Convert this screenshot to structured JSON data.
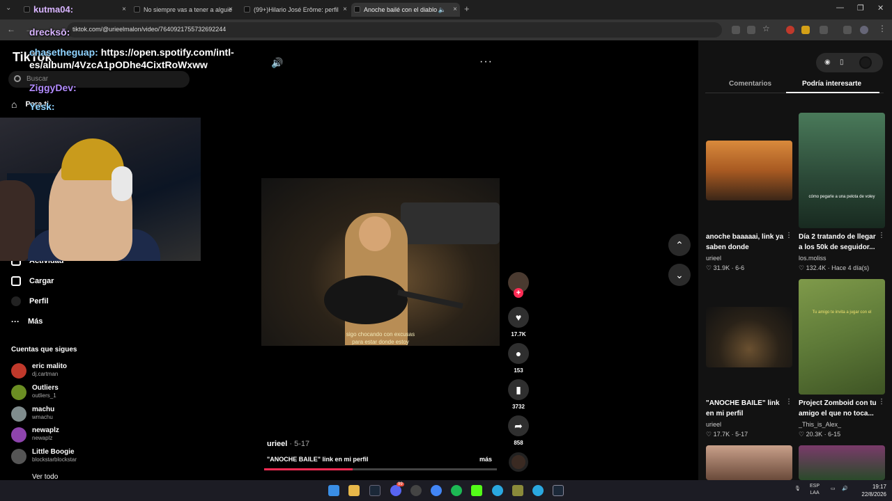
{
  "browser": {
    "tabs": [
      {
        "label": "kutma04:",
        "active": false
      },
      {
        "label": "No siempre vas a tener a alguie",
        "active": false
      },
      {
        "label": "(99+)Hilario José Erôme: perfil",
        "active": false
      },
      {
        "label": "Anoche bailé con el diablo",
        "active": true
      }
    ],
    "url": "tiktok.com/@urieelmalon/video/7640921755732692244"
  },
  "chat": [
    {
      "user": "drecksō:",
      "text": ""
    },
    {
      "user": "chasetheguap:",
      "text": "https://open.spotify.com/intl-es/album/4VzcA1pODhe4CixtRoWxww"
    },
    {
      "user": "ZiggyDev:",
      "text": ""
    },
    {
      "user": "Yesk:",
      "text": ""
    }
  ],
  "sidebar": {
    "logo": "TikTok",
    "search_placeholder": "Buscar",
    "items": [
      {
        "label": "Para ti"
      },
      {
        "label": "Actividad"
      },
      {
        "label": "Cargar"
      },
      {
        "label": "Perfil"
      },
      {
        "label": "Más"
      }
    ],
    "following_title": "Cuentas que sigues",
    "accounts": [
      {
        "name": "eric malito",
        "handle": "dj.cartman",
        "color": "#c0392b"
      },
      {
        "name": "Outliers",
        "handle": "outliers_1",
        "color": "#6b8e23"
      },
      {
        "name": "machu",
        "handle": "wmachu",
        "color": "#7f8c8d"
      },
      {
        "name": "newaplz",
        "handle": "newaplz",
        "color": "#8e44ad"
      },
      {
        "name": "Little Boogie",
        "handle": "blockstarblockstar",
        "color": "#555555"
      }
    ],
    "see_all": "Ver todo"
  },
  "video": {
    "subtitle_line1": "sigo chocando con excusas",
    "subtitle_line2": "para estar donde estoy",
    "author": "urieel",
    "date": "5-17",
    "description": "\"ANOCHE BAILE\" link en mi perfil",
    "more": "más",
    "progress": 0.38
  },
  "actions": {
    "likes": "17.7K",
    "comments": "153",
    "saves": "3732",
    "shares": "858"
  },
  "right_panel": {
    "tabs": [
      {
        "label": "Comentarios",
        "active": false
      },
      {
        "label": "Podría interesarte",
        "active": true
      }
    ],
    "cards": [
      {
        "title": "anoche baaaaai, link ya saben donde",
        "user": "urieel",
        "meta": "♡ 31.9K · 6-6",
        "caption": ""
      },
      {
        "title": "Día 2 tratando de llegar a los 50k de seguidor...",
        "user": "los.moliss",
        "meta": "♡ 132.4K · Hace 4 día(s)",
        "caption": "cómo pegarle a una pelota de voley"
      },
      {
        "title": "\"ANOCHE BAILE\" link en mi perfil",
        "user": "urieel",
        "meta": "♡ 17.7K · 5-17",
        "caption": ""
      },
      {
        "title": "Project Zomboid con tu amigo el que no toca...",
        "user": "_This_is_Alex_",
        "meta": "♡ 20.3K · 6-15",
        "caption": "Tu amigo te invita a jugar con el"
      }
    ]
  },
  "taskbar": {
    "lang_top": "ESP",
    "lang_bottom": "LAA",
    "time": "19:17",
    "date": "22/8/2026",
    "badge": "99"
  }
}
